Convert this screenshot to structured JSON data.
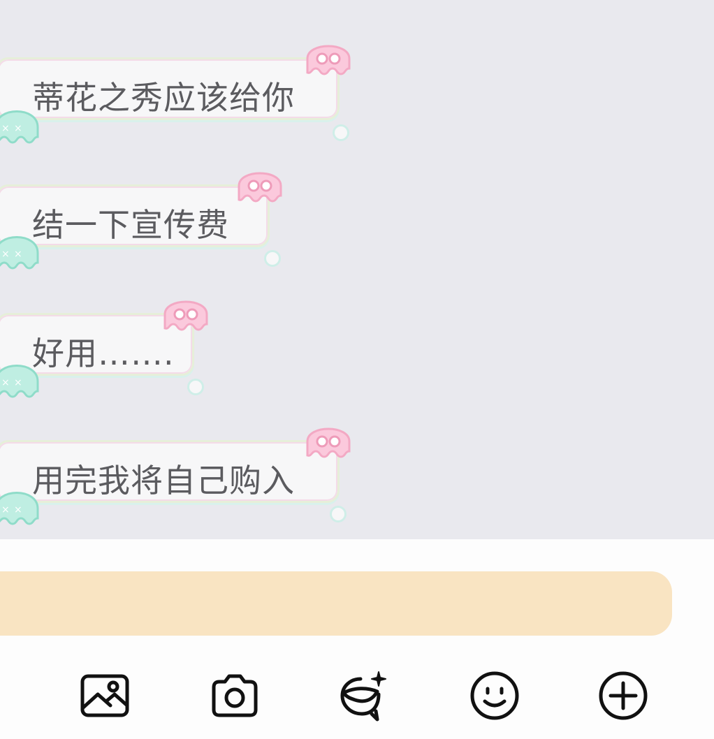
{
  "messages": [
    {
      "text": "蒂花之秀应该给你"
    },
    {
      "text": "结一下宣传费"
    },
    {
      "text": "好用……."
    },
    {
      "text": "用完我将自己购入"
    }
  ],
  "input": {
    "value": "",
    "placeholder": ""
  },
  "toolbar": {
    "icons": [
      "image-icon",
      "camera-icon",
      "sticker-spark-icon",
      "smiley-icon",
      "plus-circle-icon"
    ]
  },
  "colors": {
    "chat_background": "#e9e9ee",
    "bubble_fill": "#f7f7f8",
    "bubble_text": "#5b5b5f",
    "squid_pink": "#fbc9dc",
    "squid_teal": "#bfeee2",
    "input_fill": "#f9e4c2",
    "icon_stroke": "#111111"
  }
}
